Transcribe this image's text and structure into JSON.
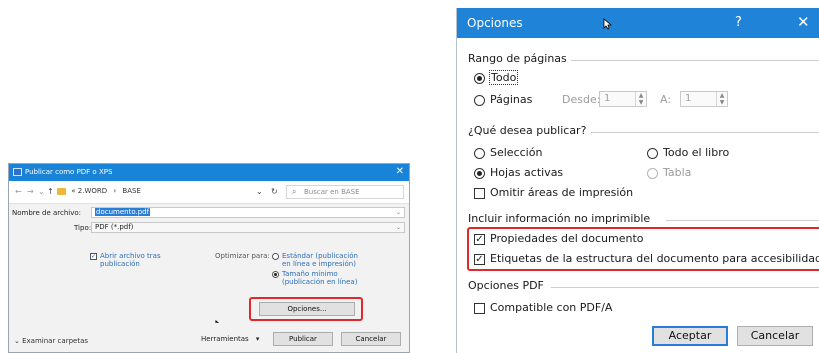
{
  "publish_dialog": {
    "title": "Publicar como PDF o XPS",
    "close_glyph": "✕",
    "nav": {
      "back_glyph": "←",
      "forward_glyph": "→",
      "recent_glyph": "⌄",
      "up_glyph": "↑",
      "breadcrumb": [
        "2.WORD",
        "BASE"
      ],
      "breadcrumb_sep": "›",
      "breadcrumb_prefix": "«",
      "dropdown_glyph": "⌄",
      "refresh_glyph": "↻",
      "search_placeholder": "Buscar en BASE"
    },
    "filename_label": "Nombre de archivo:",
    "filename_value": "documento.pdf",
    "type_label": "Tipo:",
    "type_value": "PDF (*.pdf)",
    "open_after_label_1": "Abrir archivo tras",
    "open_after_label_2": "publicación",
    "optimize_label": "Optimizar para:",
    "opt_standard_1": "Estándar (publicación",
    "opt_standard_2": "en línea e impresión)",
    "opt_min_1": "Tamaño mínimo",
    "opt_min_2": "(publicación en línea)",
    "options_button": "Opciones...",
    "browse_folders": "Examinar carpetas",
    "tools_label": "Herramientas",
    "publish_button": "Publicar",
    "cancel_button": "Cancelar"
  },
  "options_dialog": {
    "title": "Opciones",
    "help_glyph": "?",
    "close_glyph": "✕",
    "page_range": {
      "header": "Rango de páginas",
      "all_label": "Todo",
      "pages_label": "Páginas",
      "from_label": "Desde:",
      "from_value": "1",
      "to_label": "A:",
      "to_value": "1"
    },
    "publish_what": {
      "header": "¿Qué desea publicar?",
      "selection": "Selección",
      "whole_book": "Todo el libro",
      "active_sheets": "Hojas activas",
      "table": "Tabla",
      "omit_print_areas": "Omitir áreas de impresión"
    },
    "non_printable": {
      "header": "Incluir información no imprimible",
      "doc_properties": "Propiedades del documento",
      "structure_tags": "Etiquetas de la estructura del documento para accesibilidad"
    },
    "pdf_options": {
      "header": "Opciones PDF",
      "pdfa": "Compatible con PDF/A"
    },
    "ok_button": "Aceptar",
    "cancel_button": "Cancelar"
  },
  "colors": {
    "title_bar": "#1f84d8",
    "highlight": "#e0282d",
    "link": "#2d6db8"
  }
}
